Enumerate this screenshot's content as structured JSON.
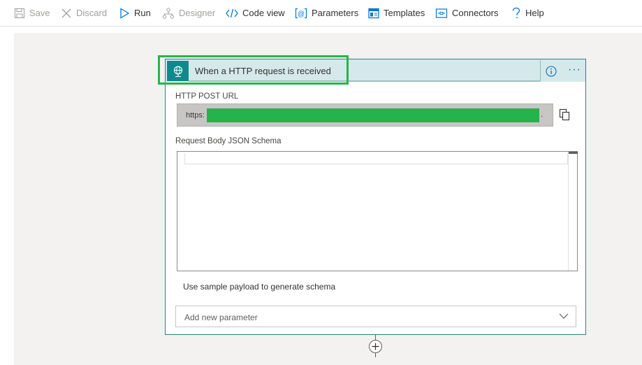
{
  "toolbar": {
    "save": "Save",
    "discard": "Discard",
    "run": "Run",
    "designer": "Designer",
    "code_view": "Code view",
    "parameters": "Parameters",
    "templates": "Templates",
    "connectors": "Connectors",
    "help": "Help"
  },
  "trigger": {
    "title": "When a HTTP request is received",
    "url_label": "HTTP POST URL",
    "url_prefix": "https:",
    "url_suffix": ".",
    "schema_label": "Request Body JSON Schema",
    "sample_payload": "Use sample payload to generate schema",
    "add_param_placeholder": "Add new parameter"
  },
  "icons": {
    "save": "save-icon",
    "discard": "close-icon",
    "run": "play-icon",
    "designer": "designer-icon",
    "code_view": "code-icon",
    "parameters": "parameters-icon",
    "templates": "templates-icon",
    "connectors": "connectors-icon",
    "help": "help-icon",
    "trigger": "http-request-icon",
    "info": "info-icon",
    "more": "more-icon",
    "copy": "copy-icon",
    "chevron": "chevron-down-icon",
    "add": "plus-icon"
  },
  "colors": {
    "accent": "#0078d4",
    "header_bg": "#d5e9eb",
    "trigger_icon_bg": "#0e8a8c",
    "card_border": "#2d7f83",
    "focus_outline": "#2ab34a",
    "url_mask": "#25b34d"
  }
}
